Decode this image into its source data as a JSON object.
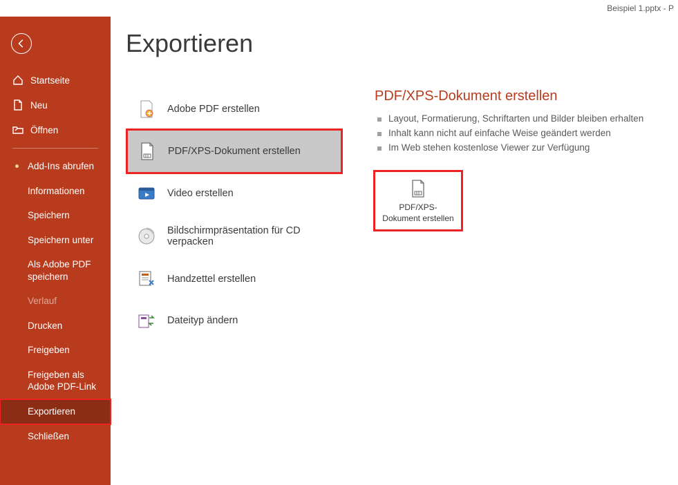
{
  "titlebar": {
    "filename": "Beispiel 1.pptx  -  P"
  },
  "heading": "Exportieren",
  "sidebar": {
    "primary": [
      {
        "label": "Startseite",
        "icon": "home"
      },
      {
        "label": "Neu",
        "icon": "new-file"
      },
      {
        "label": "Öffnen",
        "icon": "open-folder"
      }
    ],
    "secondary": [
      {
        "label": "Add-Ins abrufen",
        "dot": true
      },
      {
        "label": "Informationen"
      },
      {
        "label": "Speichern"
      },
      {
        "label": "Speichern unter"
      },
      {
        "label": "Als Adobe PDF speichern"
      },
      {
        "label": "Verlauf",
        "muted": true
      },
      {
        "label": "Drucken"
      },
      {
        "label": "Freigeben"
      },
      {
        "label": "Freigeben als Adobe PDF-Link"
      },
      {
        "label": "Exportieren",
        "active": true
      },
      {
        "label": "Schließen"
      }
    ]
  },
  "exportOptions": [
    {
      "label": "Adobe PDF erstellen",
      "icon": "adobe-pdf"
    },
    {
      "label": "PDF/XPS-Dokument erstellen",
      "icon": "pdfxps",
      "selected": true
    },
    {
      "label": "Video erstellen",
      "icon": "video"
    },
    {
      "label": "Bildschirmpräsentation für CD verpacken",
      "icon": "cd"
    },
    {
      "label": "Handzettel erstellen",
      "icon": "handout"
    },
    {
      "label": "Dateityp ändern",
      "icon": "change-type"
    }
  ],
  "detail": {
    "title": "PDF/XPS-Dokument erstellen",
    "bullets": [
      "Layout, Formatierung, Schriftarten und Bilder bleiben erhalten",
      "Inhalt kann nicht auf einfache Weise geändert werden",
      "Im Web stehen kostenlose Viewer zur Verfügung"
    ],
    "action": {
      "label_line1": "PDF/XPS-",
      "label_line2": "Dokument erstellen"
    }
  }
}
